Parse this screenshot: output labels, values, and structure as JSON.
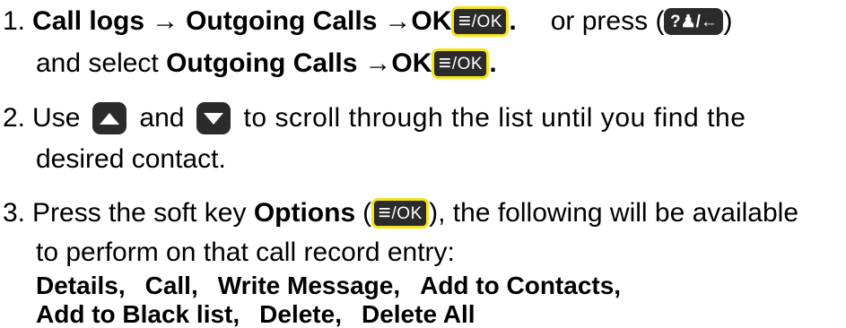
{
  "step1": {
    "number": "1.",
    "path_part1": "Call logs",
    "arrow1": "→",
    "path_part2": "Outgoing Calls",
    "arrow2": "→",
    "path_part3": "OK",
    "after_key": ".",
    "or_press": "or press (",
    "close_paren": ")",
    "line2_prefix": "and select ",
    "line2_bold": "Outgoing Calls",
    "line2_arrow": "→",
    "line2_ok": "OK",
    "line2_end": "."
  },
  "step2": {
    "number": "2.",
    "use": "Use",
    "and": "and",
    "rest": "to scroll through the list until you find the",
    "line2": "desired contact."
  },
  "step3": {
    "number": "3.",
    "press_prefix": "Press the soft key ",
    "options": "Options",
    "open_paren": "(",
    "after_key": "), the following will be available",
    "line2": "to perform on that call record entry:",
    "options_line1": [
      "Details,",
      "Call,",
      "Write Message,",
      "Add to Contacts,"
    ],
    "options_line2": [
      "Add to Black list,",
      "Delete,",
      "Delete All"
    ]
  },
  "keys": {
    "menu_glyph": "≡",
    "ok_text": "/OK",
    "back_text": "?♟/←"
  },
  "colors": {
    "key_bg": "#2b2b2b",
    "ok_highlight": "#f5e31c",
    "text": "#000000"
  },
  "icons": {
    "ok_key": "menu-ok-key-icon",
    "back_key": "contacts-back-key-icon",
    "up_key": "up-arrow-key-icon",
    "down_key": "down-arrow-key-icon"
  }
}
